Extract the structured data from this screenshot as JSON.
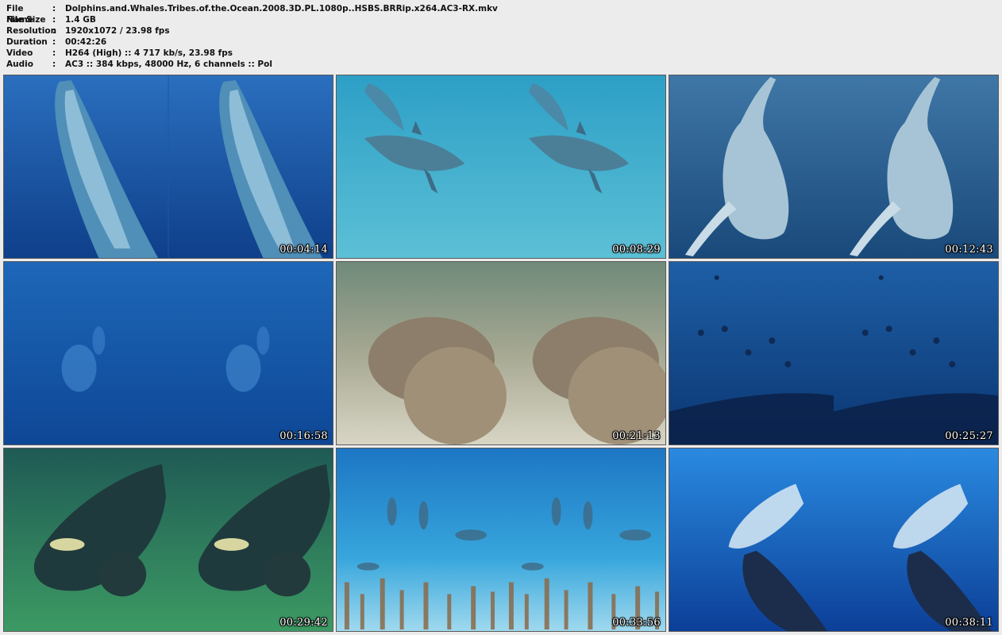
{
  "info": [
    {
      "label": "File Name",
      "value": "Dolphins.and.Whales.Tribes.of.the.Ocean.2008.3D.PL.1080p..HSBS.BRRip.x264.AC3-RX.mkv"
    },
    {
      "label": "File Size",
      "value": "1.4 GB"
    },
    {
      "label": "Resolution",
      "value": "1920x1072 / 23.98 fps"
    },
    {
      "label": "Duration",
      "value": "00:42:26"
    },
    {
      "label": "Video",
      "value": "H264 (High) :: 4 717 kb/s, 23.98 fps"
    },
    {
      "label": "Audio",
      "value": "AC3 :: 384 kbps, 48000 Hz, 6 channels :: Pol"
    }
  ],
  "separator": ":",
  "thumbnails": [
    {
      "time": "00:04:14",
      "scene": "sperm-whale-descending"
    },
    {
      "time": "00:08:29",
      "scene": "spotted-dolphins"
    },
    {
      "time": "00:12:43",
      "scene": "humpback-whale-ascending"
    },
    {
      "time": "00:16:58",
      "scene": "distant-dolphins-deep-blue"
    },
    {
      "time": "00:21:13",
      "scene": "manatees-on-seabed"
    },
    {
      "time": "00:25:27",
      "scene": "dolphin-pod-over-fish-school"
    },
    {
      "time": "00:29:42",
      "scene": "right-whale-green-water"
    },
    {
      "time": "00:33:56",
      "scene": "dolphins-over-seagrass"
    },
    {
      "time": "00:38:11",
      "scene": "humpback-whales-pair"
    }
  ]
}
